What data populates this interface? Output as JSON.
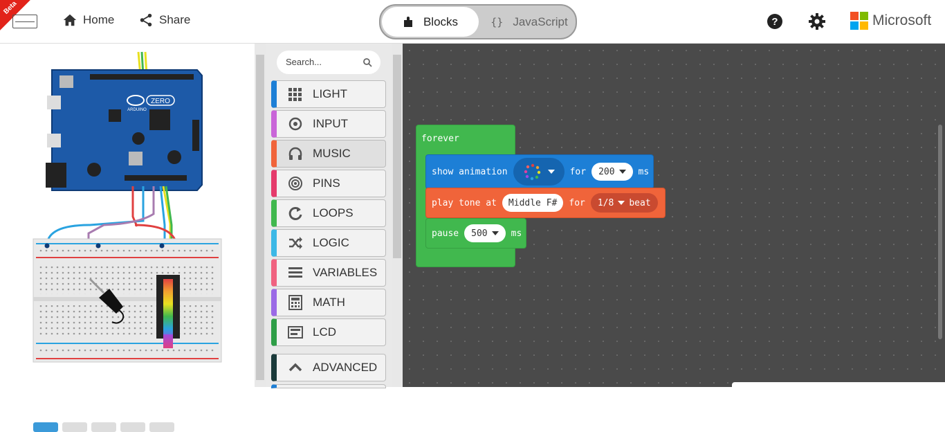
{
  "header": {
    "beta_label": "Beta",
    "home_label": "Home",
    "share_label": "Share",
    "blocks_label": "Blocks",
    "javascript_label": "JavaScript",
    "brand_label": "Microsoft"
  },
  "simulator": {
    "board_name": "ZERO",
    "board_brand": "ARDUINO"
  },
  "toolbox": {
    "search_placeholder": "Search...",
    "categories": [
      {
        "label": "LIGHT",
        "color": "#1d7fd6",
        "icon": "grid-icon"
      },
      {
        "label": "INPUT",
        "color": "#c965d8",
        "icon": "target-icon"
      },
      {
        "label": "MUSIC",
        "color": "#f0643a",
        "icon": "headphones-icon"
      },
      {
        "label": "PINS",
        "color": "#e53a6b",
        "icon": "pins-icon"
      },
      {
        "label": "LOOPS",
        "color": "#41b84e",
        "icon": "loop-icon"
      },
      {
        "label": "LOGIC",
        "color": "#3cb8e6",
        "icon": "shuffle-icon"
      },
      {
        "label": "VARIABLES",
        "color": "#f06280",
        "icon": "list-icon"
      },
      {
        "label": "MATH",
        "color": "#9b6ae6",
        "icon": "calculator-icon"
      },
      {
        "label": "LCD",
        "color": "#2e9e47",
        "icon": "lcd-icon"
      },
      {
        "label": "ADVANCED",
        "color": "#1a3a3a",
        "icon": "chevron-up-icon"
      }
    ]
  },
  "workspace": {
    "forever_label": "forever",
    "show_animation_label": "show animation",
    "for_label": "for",
    "ms_label": "ms",
    "animation_duration": "200",
    "play_tone_label": "play tone at",
    "tone_note": "Middle F#",
    "beat_fraction": "1/8",
    "beat_label": "beat",
    "pause_label": "pause",
    "pause_duration": "500"
  },
  "colors": {
    "forever": "#41b84e",
    "light": "#1d7fd6",
    "music": "#f0643a",
    "workspace_bg": "#4a4a4a"
  }
}
